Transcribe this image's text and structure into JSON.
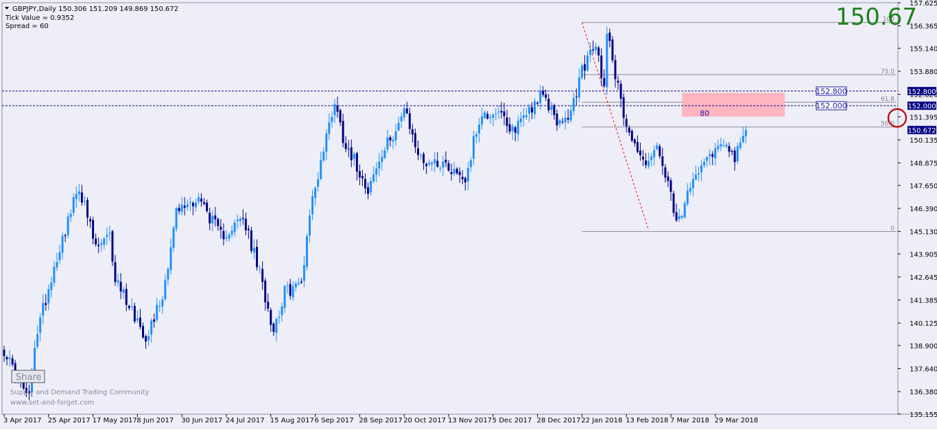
{
  "header": {
    "title_line": "GBPJPY,Daily  150.306 151.209 149.869 150.672",
    "tick_value": "Tick Value = 0.9352",
    "spread": "Spread = 60"
  },
  "big_price": "150.67",
  "watermark": {
    "line1": "Supply and Demand Trading Community",
    "line2": "www.set-and-forget.com"
  },
  "share_label": "Share",
  "zone_label": "80",
  "colors": {
    "background": "#eeeef8",
    "bull": "#1e90ff",
    "bear": "#000080",
    "grid": "#b0b0c8",
    "zone": "#ffb6c1",
    "fib": "#8a8a8a",
    "trend": "#ff0000",
    "price_box": "#000080",
    "circle": "#c00000",
    "big_price": "#1d7f1d"
  },
  "chart_data": {
    "type": "candlestick",
    "symbol": "GBPJPY",
    "timeframe": "Daily",
    "ylim": [
      135.15,
      157.625
    ],
    "y_ticks": [
      157.625,
      156.365,
      155.14,
      153.88,
      152.62,
      151.395,
      150.135,
      148.875,
      147.65,
      146.39,
      145.13,
      143.905,
      142.645,
      141.385,
      140.125,
      138.9,
      137.64,
      136.38,
      135.155
    ],
    "y_tick_labels": [
      "157.625",
      "156.365",
      "155.140",
      "153.880",
      "152.620",
      "151.395",
      "150.135",
      "148.875",
      "147.650",
      "146.390",
      "145.130",
      "143.905",
      "142.645",
      "141.385",
      "140.125",
      "138.900",
      "137.640",
      "136.380",
      "135.155"
    ],
    "x_labels": [
      {
        "label": "3 Apr 2017",
        "bar": 0
      },
      {
        "label": "25 Apr 2017",
        "bar": 16
      },
      {
        "label": "17 May 2017",
        "bar": 32
      },
      {
        "label": "8 Jun 2017",
        "bar": 48
      },
      {
        "label": "30 Jun 2017",
        "bar": 64
      },
      {
        "label": "24 Jul 2017",
        "bar": 80
      },
      {
        "label": "15 Aug 2017",
        "bar": 96
      },
      {
        "label": "6 Sep 2017",
        "bar": 112
      },
      {
        "label": "28 Sep 2017",
        "bar": 128
      },
      {
        "label": "20 Oct 2017",
        "bar": 144
      },
      {
        "label": "13 Nov 2017",
        "bar": 160
      },
      {
        "label": "5 Dec 2017",
        "bar": 176
      },
      {
        "label": "28 Dec 2017",
        "bar": 192
      },
      {
        "label": "22 Jan 2018",
        "bar": 208
      },
      {
        "label": "13 Feb 2018",
        "bar": 224
      },
      {
        "label": "7 Mar 2018",
        "bar": 240
      },
      {
        "label": "29 Mar 2018",
        "bar": 256
      }
    ],
    "anchors": [
      {
        "bar": 0,
        "price": 138.7
      },
      {
        "bar": 4,
        "price": 137.3
      },
      {
        "bar": 9,
        "price": 136.0
      },
      {
        "bar": 12,
        "price": 139.8
      },
      {
        "bar": 20,
        "price": 144.3
      },
      {
        "bar": 27,
        "price": 147.6
      },
      {
        "bar": 33,
        "price": 144.2
      },
      {
        "bar": 38,
        "price": 144.8
      },
      {
        "bar": 40,
        "price": 142.6
      },
      {
        "bar": 51,
        "price": 139.4
      },
      {
        "bar": 57,
        "price": 141.6
      },
      {
        "bar": 62,
        "price": 146.2
      },
      {
        "bar": 70,
        "price": 147.0
      },
      {
        "bar": 78,
        "price": 144.9
      },
      {
        "bar": 86,
        "price": 145.8
      },
      {
        "bar": 91,
        "price": 143.4
      },
      {
        "bar": 97,
        "price": 139.8
      },
      {
        "bar": 101,
        "price": 141.8
      },
      {
        "bar": 107,
        "price": 142.3
      },
      {
        "bar": 110,
        "price": 146.2
      },
      {
        "bar": 117,
        "price": 151.0
      },
      {
        "bar": 119,
        "price": 152.3
      },
      {
        "bar": 122,
        "price": 150.3
      },
      {
        "bar": 128,
        "price": 148.4
      },
      {
        "bar": 131,
        "price": 147.5
      },
      {
        "bar": 138,
        "price": 149.9
      },
      {
        "bar": 144,
        "price": 151.7
      },
      {
        "bar": 150,
        "price": 149.0
      },
      {
        "bar": 158,
        "price": 148.9
      },
      {
        "bar": 166,
        "price": 148.0
      },
      {
        "bar": 171,
        "price": 151.3
      },
      {
        "bar": 178,
        "price": 151.8
      },
      {
        "bar": 182,
        "price": 150.4
      },
      {
        "bar": 187,
        "price": 151.5
      },
      {
        "bar": 193,
        "price": 152.5
      },
      {
        "bar": 196,
        "price": 152.0
      },
      {
        "bar": 201,
        "price": 150.8
      },
      {
        "bar": 205,
        "price": 152.1
      },
      {
        "bar": 208,
        "price": 154.0
      },
      {
        "bar": 213,
        "price": 155.3
      },
      {
        "bar": 216,
        "price": 153.0
      },
      {
        "bar": 217,
        "price": 156.3
      },
      {
        "bar": 222,
        "price": 152.1
      },
      {
        "bar": 226,
        "price": 150.2
      },
      {
        "bar": 230,
        "price": 148.9
      },
      {
        "bar": 235,
        "price": 149.6
      },
      {
        "bar": 239,
        "price": 147.7
      },
      {
        "bar": 242,
        "price": 145.4
      },
      {
        "bar": 246,
        "price": 147.0
      },
      {
        "bar": 251,
        "price": 149.1
      },
      {
        "bar": 256,
        "price": 149.6
      },
      {
        "bar": 260,
        "price": 150.2
      },
      {
        "bar": 263,
        "price": 149.0
      },
      {
        "bar": 267,
        "price": 150.672
      }
    ],
    "horizontal_lines": [
      {
        "price": 152.8,
        "label": "152.800"
      },
      {
        "price": 152.0,
        "label": "152.000"
      }
    ],
    "current_price": {
      "price": 150.672,
      "label": "150.672"
    },
    "fibonacci": {
      "start_bar": 208,
      "end_bar": 327,
      "high": 156.55,
      "low": 145.13,
      "levels": [
        {
          "ratio": 1.0,
          "label": "100",
          "price": 156.55
        },
        {
          "ratio": 0.75,
          "label": "75.0",
          "price": 153.695
        },
        {
          "ratio": 0.618,
          "label": "61.8",
          "price": 152.187
        },
        {
          "ratio": 0.5,
          "label": "50.0",
          "price": 150.84
        },
        {
          "ratio": 0.0,
          "label": "0",
          "price": 145.13
        }
      ]
    },
    "trendline": {
      "bar1": 208,
      "price1": 156.55,
      "bar2": 232,
      "price2": 145.2
    },
    "zone": {
      "bar1": 244,
      "bar2": 281,
      "price_top": 152.7,
      "price_bottom": 151.4,
      "label": "80"
    },
    "level_boxes": [
      {
        "label": "152.800",
        "price": 152.8,
        "color": "#1a1aa0"
      },
      {
        "label": "152.000",
        "price": 152.0,
        "color": "#1a1aa0"
      }
    ],
    "bar_count": 268
  }
}
